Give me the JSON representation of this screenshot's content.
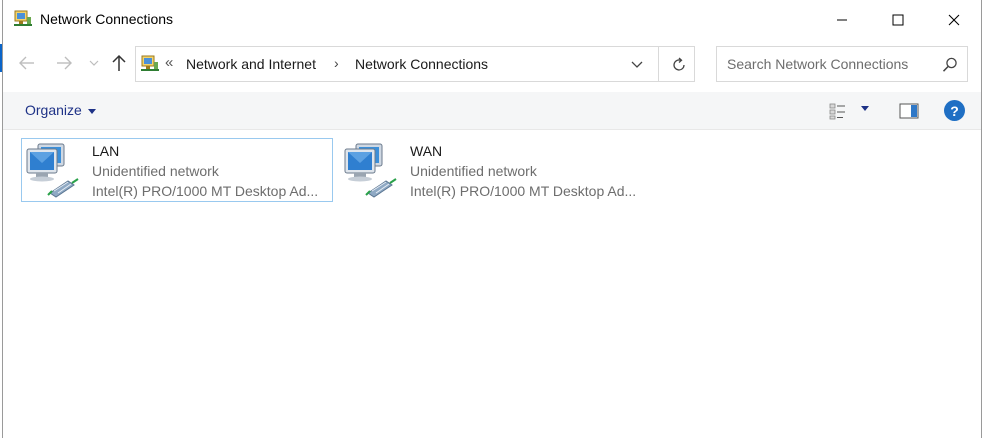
{
  "window": {
    "title": "Network Connections"
  },
  "navigation": {
    "address": {
      "overflow_chevron": "«",
      "crumbs": [
        "Network and Internet",
        "Network Connections"
      ],
      "separator": "›"
    },
    "search": {
      "placeholder": "Search Network Connections"
    }
  },
  "command_bar": {
    "organize_label": "Organize",
    "help_label": "?"
  },
  "connections": [
    {
      "name": "LAN",
      "status": "Unidentified network",
      "device": "Intel(R) PRO/1000 MT Desktop Ad..."
    },
    {
      "name": "WAN",
      "status": "Unidentified network",
      "device": "Intel(R) PRO/1000 MT Desktop Ad..."
    }
  ],
  "colors": {
    "accent": "#1e3287",
    "selection_border": "#99c9ef",
    "help_blue": "#1f6fc4"
  }
}
